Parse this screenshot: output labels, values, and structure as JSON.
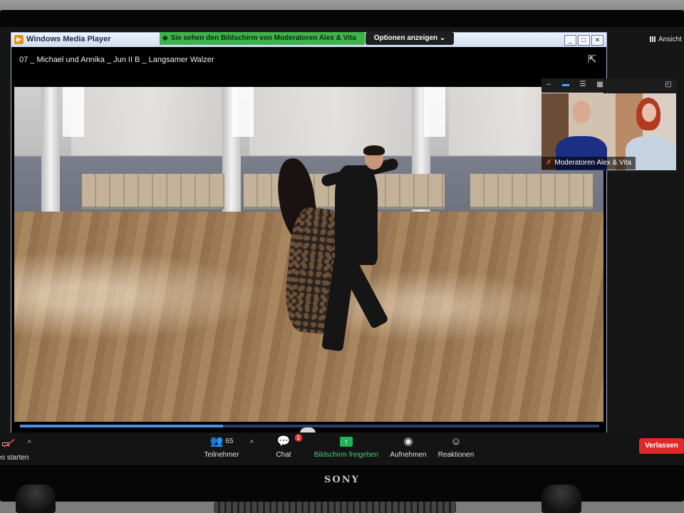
{
  "wmp": {
    "window_title": "Windows Media Player",
    "media_title": "07 _ Michael  und Annika _ Jun II B _ Langsamer Walzer",
    "progress_fraction": 0.35
  },
  "zoom": {
    "share_banner": "Sie sehen den Bildschirm von Moderatoren Alex & Vita",
    "options_label": "Optionen anzeigen",
    "view_label": "Ansicht",
    "participant_name": "Moderatoren Alex & Vita",
    "toolbar": {
      "video_label": "eo starten",
      "participants_label": "Teilnehmer",
      "participants_count": "65",
      "chat_label": "Chat",
      "chat_badge": "1",
      "share_label": "Bildschirm freigeben",
      "record_label": "Aufnehmen",
      "reactions_label": "Reaktionen",
      "leave_label": "Verlassen"
    }
  },
  "monitor": {
    "brand": "SONY"
  },
  "icons": {
    "close": "close-icon",
    "maximize": "maximize-icon",
    "minimize": "minimize-icon",
    "fullscreen": "fullscreen-icon"
  },
  "colors": {
    "share_green": "#3fb24b",
    "leave_red": "#e02828",
    "accent_blue": "#4a90e2"
  }
}
